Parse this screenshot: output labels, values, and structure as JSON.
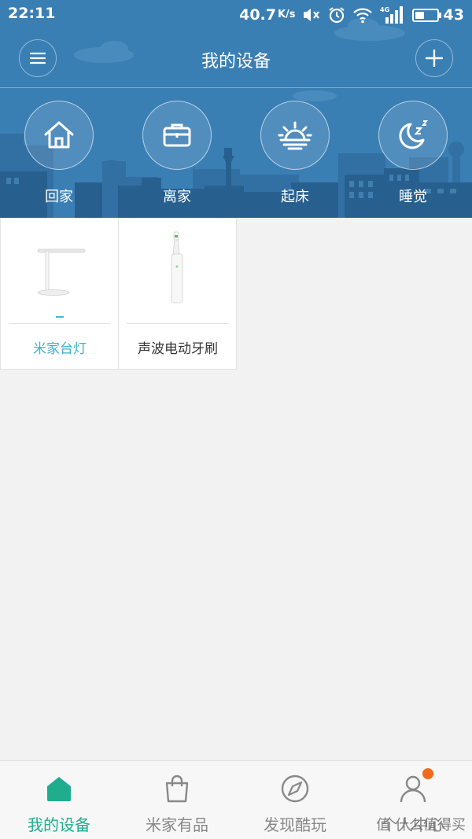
{
  "status_bar": {
    "time": "22:11",
    "net_speed": "40.7",
    "net_speed_unit": "K/s",
    "battery_level": 43,
    "battery_text": "43",
    "icons": [
      "mute-icon",
      "alarm-icon",
      "wifi-icon",
      "signal-4g-icon",
      "battery-icon"
    ]
  },
  "header": {
    "title": "我的设备",
    "menu_icon": "menu-icon",
    "add_icon": "plus-icon"
  },
  "scenes": [
    {
      "label": "回家",
      "icon": "home-icon"
    },
    {
      "label": "离家",
      "icon": "briefcase-icon"
    },
    {
      "label": "起床",
      "icon": "sunrise-icon"
    },
    {
      "label": "睡觉",
      "icon": "moon-sleep-icon"
    }
  ],
  "devices": [
    {
      "name": "米家台灯",
      "icon": "desk-lamp-icon",
      "active": true
    },
    {
      "name": "声波电动牙刷",
      "icon": "toothbrush-icon",
      "active": false
    }
  ],
  "bottom_nav": [
    {
      "label": "我的设备",
      "icon": "home-filled-icon",
      "active": true
    },
    {
      "label": "米家有品",
      "icon": "shopping-bag-icon",
      "active": false
    },
    {
      "label": "发现酷玩",
      "icon": "compass-icon",
      "active": false
    },
    {
      "label": "个人中心",
      "icon": "person-icon",
      "active": false,
      "badge": true
    }
  ],
  "watermark": "值 什么值得买",
  "colors": {
    "header_bg": "#3a7fb4",
    "skyline_dark": "#27608f",
    "accent_green": "#20ad8e",
    "accent_cyan": "#3fb0c9",
    "badge_orange": "#f26a1b",
    "page_bg": "#f2f2f2"
  }
}
